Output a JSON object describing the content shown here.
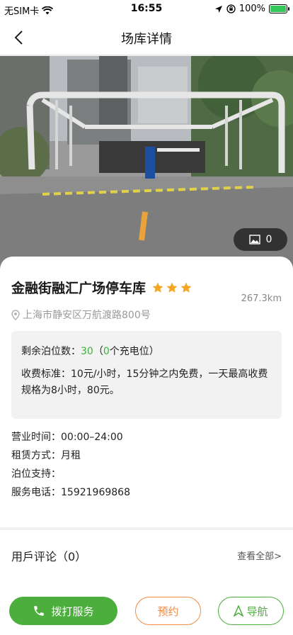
{
  "status_bar": {
    "carrier": "无SIM卡",
    "time": "16:55",
    "battery": "100%"
  },
  "nav": {
    "title": "场库详情"
  },
  "gallery": {
    "photo_count": "0"
  },
  "lot": {
    "name": "金融街融汇广场停车库",
    "rating": 3,
    "distance": "267.3km",
    "address": "上海市静安区万航渡路800号"
  },
  "info": {
    "spaces_label": "剩余泊位数：",
    "spaces_value": "30",
    "charging_open": "（",
    "charging_value": "0",
    "charging_label": "个充电位）",
    "fee_text": "收费标准：10元/小时，15分钟之内免费，一天最高收费规格为8小时，80元。"
  },
  "details": {
    "hours": "营业时间：00:00–24:00",
    "lease": "租赁方式：月租",
    "support": "泊位支持：",
    "phone": "服务电话：15921969868"
  },
  "comments": {
    "title": "用戶评论（0）",
    "view_all": "查看全部>"
  },
  "actions": {
    "call": "拨打服务",
    "reserve": "预约",
    "navigate": "导航"
  },
  "colors": {
    "accent_green": "#4cae3c",
    "accent_orange": "#f08a45",
    "star": "#f5a623"
  }
}
